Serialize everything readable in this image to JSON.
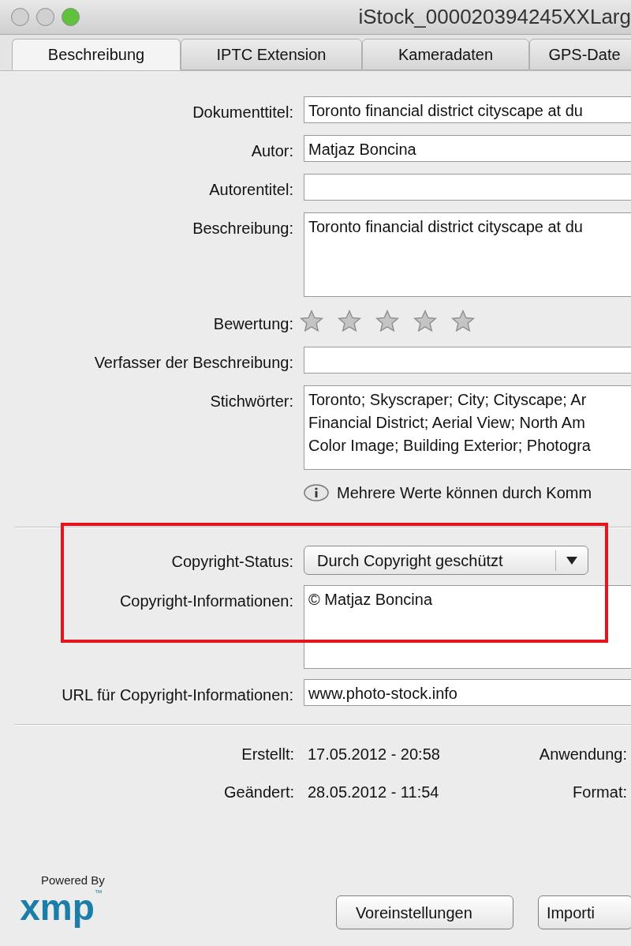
{
  "window": {
    "title": "iStock_000020394245XXLarg"
  },
  "tabs": [
    {
      "label": "Beschreibung",
      "selected": true
    },
    {
      "label": "IPTC Extension",
      "selected": false
    },
    {
      "label": "Kameradaten",
      "selected": false
    },
    {
      "label": "GPS-Date",
      "selected": false
    }
  ],
  "fields": [
    {
      "kind": "text",
      "label": "Dokumenttitel:",
      "value": "Toronto financial district cityscape at du"
    },
    {
      "kind": "text",
      "label": "Autor:",
      "value": "Matjaz Boncina"
    },
    {
      "kind": "text",
      "label": "Autorentitel:"
    },
    {
      "kind": "textarea",
      "label": "Beschreibung:",
      "value": "Toronto financial district cityscape at du"
    },
    {
      "kind": "rating",
      "label": "Bewertung:",
      "stars": 0
    },
    {
      "kind": "text",
      "label": "Verfasser der Beschreibung:"
    },
    {
      "kind": "textarea",
      "label": "Stichwörter:",
      "value": "Toronto; Skyscraper; City; Cityscape; Ar\nFinancial District; Aerial View; North Am\nColor Image; Building Exterior; Photogra"
    },
    {
      "kind": "note",
      "text": "Mehrere Werte können durch Komm"
    }
  ],
  "copyright_fields": [
    {
      "kind": "popup",
      "label": "Copyright-Status:",
      "value": "Durch Copyright geschützt"
    },
    {
      "kind": "textarea",
      "label": "Copyright-Informationen:",
      "value": "© Matjaz Boncina"
    },
    {
      "kind": "text",
      "label": "URL für Copyright-Informationen:",
      "value": "www.photo-stock.info"
    }
  ],
  "dates": [
    {
      "label": "Erstellt:",
      "value": "17.05.2012 - 20:58",
      "side_label": "Anwendung:"
    },
    {
      "label": "Geändert:",
      "value": "28.05.2012 - 11:54",
      "side_label": "Format:"
    }
  ],
  "logo": {
    "caption": "Powered By",
    "wordmark": "xmp",
    "trademark": "™"
  },
  "buttons": [
    "Voreinstellungen",
    "Importi"
  ]
}
